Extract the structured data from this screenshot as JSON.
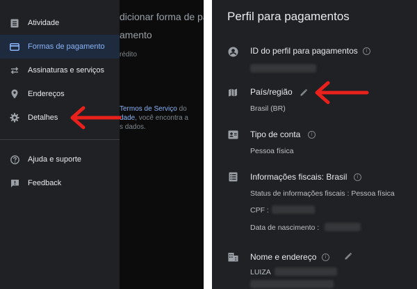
{
  "left": {
    "background_page": {
      "heading_partial": "dicionar forma de pa",
      "subheading_partial": "amento",
      "credit_partial": "rédito",
      "terms_line1_link": "Termos de Serviço",
      "terms_line1_rest": "do",
      "terms_line2_link": "dade",
      "terms_line2_rest": ", você encontra a",
      "terms_line3": "s dados."
    },
    "drawer": {
      "items": [
        {
          "label": "Atividade",
          "icon": "receipt-icon",
          "active": false
        },
        {
          "label": "Formas de pagamento",
          "icon": "credit-card-icon",
          "active": true
        },
        {
          "label": "Assinaturas e serviços",
          "icon": "repeat-icon",
          "active": false
        },
        {
          "label": "Endereços",
          "icon": "location-pin-icon",
          "active": false
        },
        {
          "label": "Detalhes",
          "icon": "gear-icon",
          "active": false
        }
      ],
      "footer_items": [
        {
          "label": "Ajuda e suporte",
          "icon": "help-icon"
        },
        {
          "label": "Feedback",
          "icon": "feedback-icon"
        }
      ]
    }
  },
  "right": {
    "title": "Perfil para pagamentos",
    "profile_id_label": "ID do perfil para pagamentos",
    "country_label": "País/região",
    "country_value": "Brasil (BR)",
    "account_type_label": "Tipo de conta",
    "account_type_value": "Pessoa física",
    "tax_info_label": "Informações fiscais: Brasil",
    "tax_status_text": "Status de informações fiscais : Pessoa física",
    "cpf_label": "CPF :",
    "birth_date_label": "Data de nascimento :",
    "name_address_label": "Nome e endereço",
    "name_value": "LUIZA"
  },
  "colors": {
    "accent_blue": "#8ab4f8",
    "arrow_red": "#e8211c",
    "panel_bg": "#202124"
  }
}
